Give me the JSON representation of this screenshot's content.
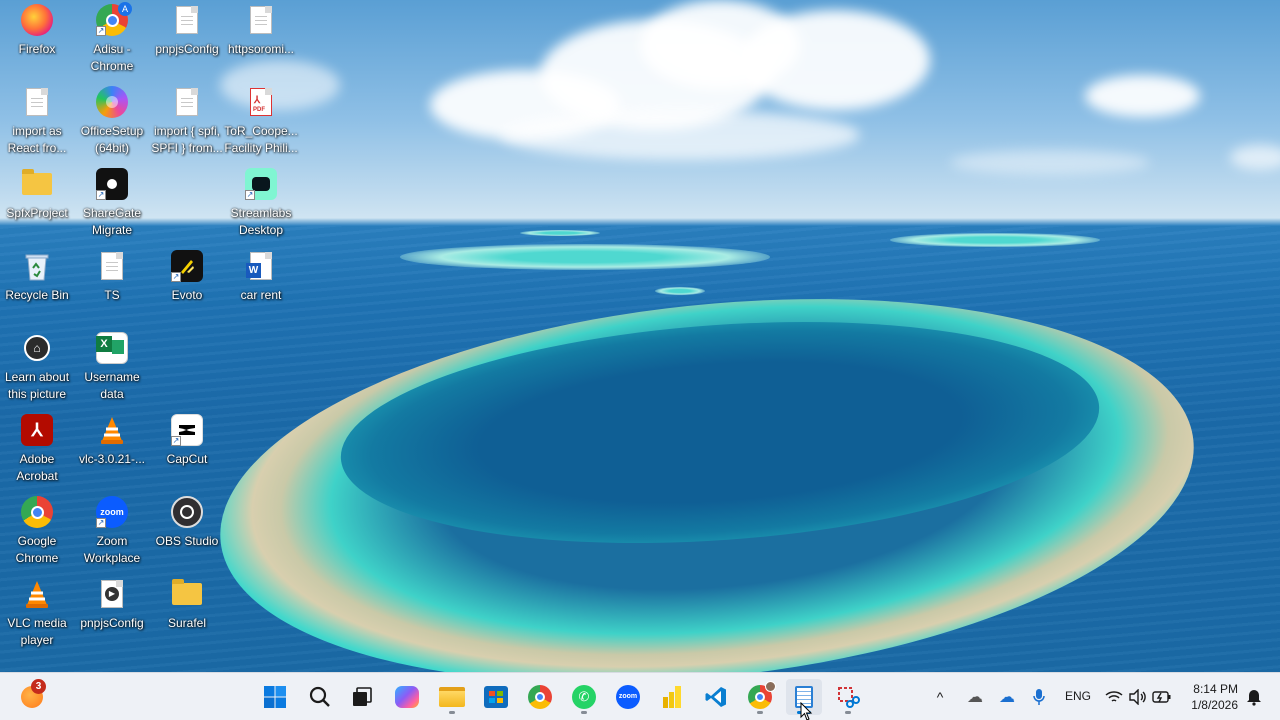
{
  "desktop": {
    "icons": [
      {
        "label": "Firefox",
        "icon": "firefox-icon"
      },
      {
        "label": "Adisu - Chrome",
        "icon": "chrome-profile-icon"
      },
      {
        "label": "pnpjsConfig",
        "icon": "document-icon"
      },
      {
        "label": "httpsoromi...",
        "icon": "document-icon"
      },
      {
        "label": "import  as React fro...",
        "icon": "document-icon"
      },
      {
        "label": "OfficeSetup (64bit)",
        "icon": "office-icon"
      },
      {
        "label": "import { spfi, SPFI } from...",
        "icon": "document-icon"
      },
      {
        "label": "ToR_Coope... Facility Phili...",
        "icon": "pdf-icon"
      },
      {
        "label": "SpfxProject",
        "icon": "folder-icon"
      },
      {
        "label": "ShareGate Migrate",
        "icon": "sharegate-icon"
      },
      {
        "label": "Streamlabs Desktop",
        "icon": "streamlabs-icon"
      },
      {
        "label": "Recycle Bin",
        "icon": "recycle-bin-icon"
      },
      {
        "label": "TS",
        "icon": "document-icon"
      },
      {
        "label": "Evoto",
        "icon": "evoto-icon"
      },
      {
        "label": "car rent",
        "icon": "word-icon"
      },
      {
        "label": "Learn about this picture",
        "icon": "spotlight-icon"
      },
      {
        "label": "Username data",
        "icon": "excel-icon"
      },
      {
        "label": "Adobe Acrobat",
        "icon": "acrobat-icon"
      },
      {
        "label": "vlc-3.0.21-...",
        "icon": "vlc-icon"
      },
      {
        "label": "CapCut",
        "icon": "capcut-icon"
      },
      {
        "label": "Google Chrome",
        "icon": "chrome-icon"
      },
      {
        "label": "Zoom Workplace",
        "icon": "zoom-icon"
      },
      {
        "label": "OBS Studio",
        "icon": "obs-icon"
      },
      {
        "label": "VLC media player",
        "icon": "vlc-icon"
      },
      {
        "label": "pnpjsConfig",
        "icon": "media-file-icon"
      },
      {
        "label": "Surafel",
        "icon": "folder-icon"
      }
    ]
  },
  "taskbar": {
    "widgets_badge": "3",
    "pinned": [
      {
        "name": "start",
        "icon": "windows-start-icon"
      },
      {
        "name": "search",
        "icon": "search-icon"
      },
      {
        "name": "task-view",
        "icon": "task-view-icon"
      },
      {
        "name": "copilot",
        "icon": "copilot-icon"
      },
      {
        "name": "file-explorer",
        "icon": "folder-icon"
      },
      {
        "name": "microsoft-store",
        "icon": "store-icon"
      },
      {
        "name": "chrome",
        "icon": "chrome-icon"
      },
      {
        "name": "whatsapp",
        "icon": "whatsapp-icon"
      },
      {
        "name": "zoom",
        "icon": "zoom-icon"
      },
      {
        "name": "power-bi",
        "icon": "power-bi-icon"
      },
      {
        "name": "vscode",
        "icon": "vscode-icon"
      },
      {
        "name": "chrome-profile",
        "icon": "chrome-profile-icon"
      },
      {
        "name": "notepad",
        "icon": "notepad-icon"
      },
      {
        "name": "snipping-tool",
        "icon": "snipping-tool-icon"
      }
    ],
    "tray": {
      "language": "ENG",
      "time": "8:14 PM",
      "date": "1/8/2026"
    }
  },
  "colors": {
    "taskbar_bg": "#eef1f6",
    "accent": "#0078d4"
  }
}
